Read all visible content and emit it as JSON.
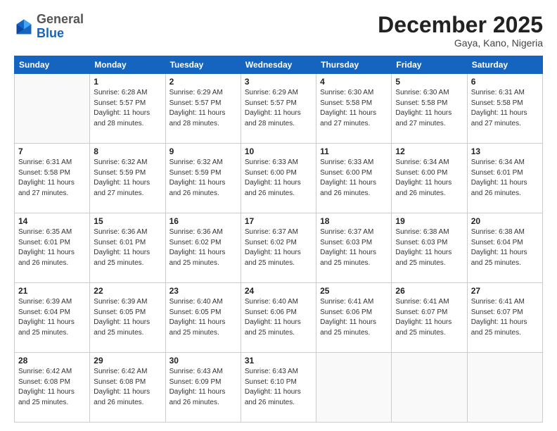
{
  "header": {
    "logo_general": "General",
    "logo_blue": "Blue",
    "month": "December 2025",
    "location": "Gaya, Kano, Nigeria"
  },
  "days_of_week": [
    "Sunday",
    "Monday",
    "Tuesday",
    "Wednesday",
    "Thursday",
    "Friday",
    "Saturday"
  ],
  "weeks": [
    [
      {
        "day": "",
        "info": ""
      },
      {
        "day": "1",
        "info": "Sunrise: 6:28 AM\nSunset: 5:57 PM\nDaylight: 11 hours\nand 28 minutes."
      },
      {
        "day": "2",
        "info": "Sunrise: 6:29 AM\nSunset: 5:57 PM\nDaylight: 11 hours\nand 28 minutes."
      },
      {
        "day": "3",
        "info": "Sunrise: 6:29 AM\nSunset: 5:57 PM\nDaylight: 11 hours\nand 28 minutes."
      },
      {
        "day": "4",
        "info": "Sunrise: 6:30 AM\nSunset: 5:58 PM\nDaylight: 11 hours\nand 27 minutes."
      },
      {
        "day": "5",
        "info": "Sunrise: 6:30 AM\nSunset: 5:58 PM\nDaylight: 11 hours\nand 27 minutes."
      },
      {
        "day": "6",
        "info": "Sunrise: 6:31 AM\nSunset: 5:58 PM\nDaylight: 11 hours\nand 27 minutes."
      }
    ],
    [
      {
        "day": "7",
        "info": "Sunrise: 6:31 AM\nSunset: 5:58 PM\nDaylight: 11 hours\nand 27 minutes."
      },
      {
        "day": "8",
        "info": "Sunrise: 6:32 AM\nSunset: 5:59 PM\nDaylight: 11 hours\nand 27 minutes."
      },
      {
        "day": "9",
        "info": "Sunrise: 6:32 AM\nSunset: 5:59 PM\nDaylight: 11 hours\nand 26 minutes."
      },
      {
        "day": "10",
        "info": "Sunrise: 6:33 AM\nSunset: 6:00 PM\nDaylight: 11 hours\nand 26 minutes."
      },
      {
        "day": "11",
        "info": "Sunrise: 6:33 AM\nSunset: 6:00 PM\nDaylight: 11 hours\nand 26 minutes."
      },
      {
        "day": "12",
        "info": "Sunrise: 6:34 AM\nSunset: 6:00 PM\nDaylight: 11 hours\nand 26 minutes."
      },
      {
        "day": "13",
        "info": "Sunrise: 6:34 AM\nSunset: 6:01 PM\nDaylight: 11 hours\nand 26 minutes."
      }
    ],
    [
      {
        "day": "14",
        "info": "Sunrise: 6:35 AM\nSunset: 6:01 PM\nDaylight: 11 hours\nand 26 minutes."
      },
      {
        "day": "15",
        "info": "Sunrise: 6:36 AM\nSunset: 6:01 PM\nDaylight: 11 hours\nand 25 minutes."
      },
      {
        "day": "16",
        "info": "Sunrise: 6:36 AM\nSunset: 6:02 PM\nDaylight: 11 hours\nand 25 minutes."
      },
      {
        "day": "17",
        "info": "Sunrise: 6:37 AM\nSunset: 6:02 PM\nDaylight: 11 hours\nand 25 minutes."
      },
      {
        "day": "18",
        "info": "Sunrise: 6:37 AM\nSunset: 6:03 PM\nDaylight: 11 hours\nand 25 minutes."
      },
      {
        "day": "19",
        "info": "Sunrise: 6:38 AM\nSunset: 6:03 PM\nDaylight: 11 hours\nand 25 minutes."
      },
      {
        "day": "20",
        "info": "Sunrise: 6:38 AM\nSunset: 6:04 PM\nDaylight: 11 hours\nand 25 minutes."
      }
    ],
    [
      {
        "day": "21",
        "info": "Sunrise: 6:39 AM\nSunset: 6:04 PM\nDaylight: 11 hours\nand 25 minutes."
      },
      {
        "day": "22",
        "info": "Sunrise: 6:39 AM\nSunset: 6:05 PM\nDaylight: 11 hours\nand 25 minutes."
      },
      {
        "day": "23",
        "info": "Sunrise: 6:40 AM\nSunset: 6:05 PM\nDaylight: 11 hours\nand 25 minutes."
      },
      {
        "day": "24",
        "info": "Sunrise: 6:40 AM\nSunset: 6:06 PM\nDaylight: 11 hours\nand 25 minutes."
      },
      {
        "day": "25",
        "info": "Sunrise: 6:41 AM\nSunset: 6:06 PM\nDaylight: 11 hours\nand 25 minutes."
      },
      {
        "day": "26",
        "info": "Sunrise: 6:41 AM\nSunset: 6:07 PM\nDaylight: 11 hours\nand 25 minutes."
      },
      {
        "day": "27",
        "info": "Sunrise: 6:41 AM\nSunset: 6:07 PM\nDaylight: 11 hours\nand 25 minutes."
      }
    ],
    [
      {
        "day": "28",
        "info": "Sunrise: 6:42 AM\nSunset: 6:08 PM\nDaylight: 11 hours\nand 25 minutes."
      },
      {
        "day": "29",
        "info": "Sunrise: 6:42 AM\nSunset: 6:08 PM\nDaylight: 11 hours\nand 26 minutes."
      },
      {
        "day": "30",
        "info": "Sunrise: 6:43 AM\nSunset: 6:09 PM\nDaylight: 11 hours\nand 26 minutes."
      },
      {
        "day": "31",
        "info": "Sunrise: 6:43 AM\nSunset: 6:10 PM\nDaylight: 11 hours\nand 26 minutes."
      },
      {
        "day": "",
        "info": ""
      },
      {
        "day": "",
        "info": ""
      },
      {
        "day": "",
        "info": ""
      }
    ]
  ]
}
